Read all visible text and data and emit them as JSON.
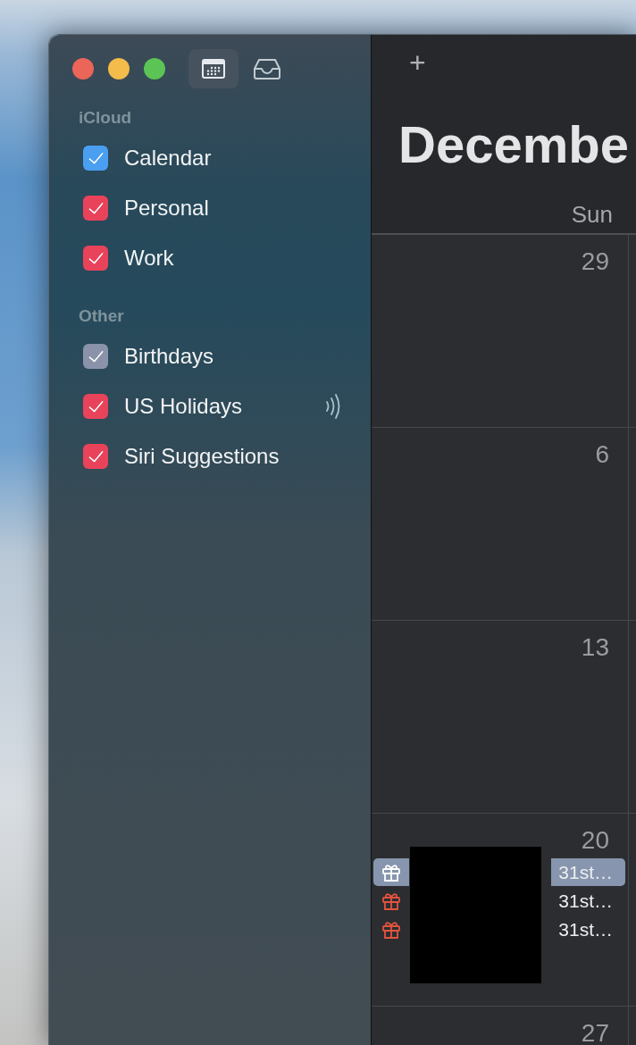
{
  "toolbar": {
    "views": [
      {
        "kind": "calendar",
        "selected": true
      },
      {
        "kind": "inbox",
        "selected": false
      }
    ],
    "add_button": "+"
  },
  "sidebar": {
    "groups": [
      {
        "title": "iCloud",
        "calendars": [
          {
            "name": "Calendar",
            "checked": true,
            "color": "#4a9ff0",
            "subscribed": false
          },
          {
            "name": "Personal",
            "checked": true,
            "color": "#e8435a",
            "subscribed": false
          },
          {
            "name": "Work",
            "checked": true,
            "color": "#e8435a",
            "subscribed": false
          }
        ]
      },
      {
        "title": "Other",
        "calendars": [
          {
            "name": "Birthdays",
            "checked": true,
            "color": "#8a93aa",
            "subscribed": false
          },
          {
            "name": "US Holidays",
            "checked": true,
            "color": "#e8435a",
            "subscribed": true
          },
          {
            "name": "Siri Suggestions",
            "checked": true,
            "color": "#e8435a",
            "subscribed": false
          }
        ]
      }
    ]
  },
  "month": {
    "title": "Decembe",
    "weekday": "Sun",
    "weeks": [
      {
        "day": "29"
      },
      {
        "day": "6"
      },
      {
        "day": "13"
      },
      {
        "day": "20",
        "redacted": true,
        "events": [
          {
            "kind": "birthday",
            "text": "31st…",
            "selected": true
          },
          {
            "kind": "birthday",
            "text": "31st…",
            "selected": false
          },
          {
            "kind": "birthday",
            "text": "31st…",
            "selected": false
          }
        ]
      },
      {
        "day": "27"
      }
    ]
  }
}
